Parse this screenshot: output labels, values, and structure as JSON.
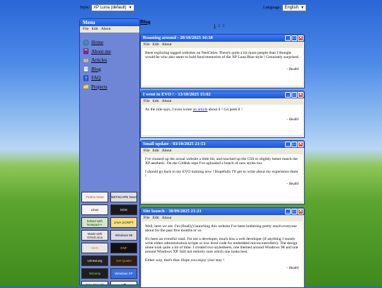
{
  "topbar": {
    "style_label": "Style:",
    "style_value": "XP Luna (default)",
    "language_label": "Language:",
    "language_value": "English"
  },
  "menu": {
    "title": "Menu",
    "bar": [
      "File",
      "Edit",
      "About"
    ],
    "items": [
      {
        "label": "Home",
        "icon": "globe-icon"
      },
      {
        "label": "About me",
        "icon": "book-icon"
      },
      {
        "label": "Articles",
        "icon": "articles-icon"
      },
      {
        "label": "Blog",
        "icon": "notepad-icon"
      },
      {
        "label": "FAQ",
        "icon": "help-book-icon"
      },
      {
        "label": "Projects",
        "icon": "folder-icon"
      }
    ],
    "badges": [
      {
        "text": "Firefox Now!",
        "bg": "#f2f2f2",
        "fg": "#c0392b"
      },
      {
        "text": "NETSCAPE Now!",
        "bg": "#e0e0e0",
        "fg": "#000000"
      },
      {
        "text": "Linux",
        "bg": "#f4f4f4",
        "fg": "#000000"
      },
      {
        "text": "DOS",
        "bg": "#1a1a1a",
        "fg": "#ffffff"
      },
      {
        "text": "Edited with Notepad++",
        "bg": "#d7e7c3",
        "fg": "#0b4a12"
      },
      {
        "text": "JAVA SCRIPT",
        "bg": "#f6e27a",
        "fg": "#1a1a1a"
      },
      {
        "text": "Made with GNU/Linux",
        "bg": "#e9e9e9",
        "fg": "#1a1a1a"
      },
      {
        "text": "Windows 98",
        "bg": "#dcdcdc",
        "fg": "#000080"
      },
      {
        "text": "MSN",
        "bg": "#e7e7e7",
        "fg": "#f57c00"
      },
      {
        "text": "DNF",
        "bg": "#111111",
        "fg": "#f0b400"
      },
      {
        "text": "Unreal.org",
        "bg": "#222222",
        "fg": "#ffffff"
      },
      {
        "text": "Get Quake",
        "bg": "#2b1e14",
        "fg": "#d89a3a"
      },
      {
        "text": "Winamp",
        "bg": "#1e1e1e",
        "fg": "#7fd07f"
      },
      {
        "text": "Windows XP",
        "bg": "#3a6ee0",
        "fg": "#ffffff"
      },
      {
        "text": "Free Speech Forever",
        "bg": "#e7eef8",
        "fg": "#1a2a7a"
      },
      {
        "text": "I ❤ download.com",
        "bg": "#f3f3f3",
        "fg": "#1a1a1a"
      }
    ]
  },
  "blog": {
    "heading": "Blog",
    "pages": [
      "1",
      "2",
      "3"
    ],
    "current_page": "1"
  },
  "posts": [
    {
      "title": "Roaming around - 20/10/2025 16:38",
      "menu": [
        "File",
        "Edit",
        "About"
      ],
      "paragraphs": [
        "Been exploring tagged websites on NeoCities. There's quite a lot more people than I thought would be who also seem to hold fond memories of the XP Luna Blue style ! Genuinely surprised."
      ],
      "signature": "– Bea84"
    },
    {
      "title": "I went to EVO ! - 13/10/2025 15:02",
      "menu": [
        "File",
        "Edit",
        "About"
      ],
      "pre_link": "As the title says, I even wrote ",
      "link": "an article",
      "post_link": " about it ! Go peek it !",
      "signature": "– Bea84"
    },
    {
      "title": "Small update - 03/10/2025 21:53",
      "menu": [
        "File",
        "Edit",
        "About"
      ],
      "paragraphs": [
        "I've cleaned up the actual website a little bit, and touched up the CSS to slightly better match the XP aesthetic. On the GitHub repo I've uploaded a bunch of new styles too.",
        "I should go back to my EVO training now ! Hopefully I'll get to write about my experience there !"
      ],
      "signature": "– Bea84"
    },
    {
      "title": "Site launch - 30/09/2025 21:21",
      "menu": [
        "File",
        "Edit",
        "About"
      ],
      "paragraphs": [
        "Well, here we are. I'm (finally) launching this website I've been bothering pretty much everyone about for the past five months or so.",
        "It's been an eventful road. I'm not a developer, much less a web developer (if anything I mostly write either administration scripts or low level code for embedded microcontrollers). The design alone took quite a lot of time. I created two stylesheets, one themed around Windows 98 and one around Windows XP. Still not entirely sure which one looks best.",
        "Either way, that's that. Hope you enjoy your stay !"
      ],
      "signature": "– Bea84"
    }
  ],
  "colors": {
    "title_bar": "#1f56d8",
    "menu_panel": "#6f86d7",
    "close_button": "#d9481f",
    "window_face": "#ece9d8"
  }
}
